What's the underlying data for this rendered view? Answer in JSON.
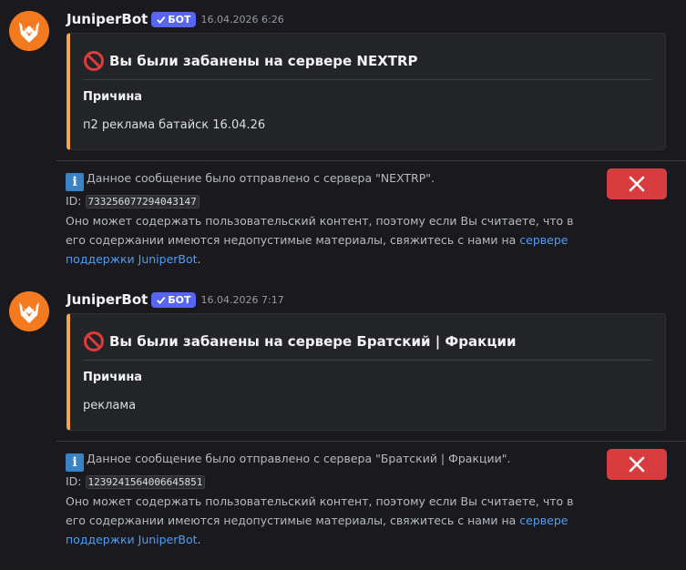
{
  "messages": [
    {
      "author": "JuniperBot",
      "badge": "БОТ",
      "timestamp": "16.04.2026 6:26",
      "embed": {
        "title": "Вы были забанены на сервере NEXTRP",
        "field_name": "Причина",
        "field_value": "п2 реклама батайск 16.04.26"
      },
      "notice": {
        "sent_from": "Данное сообщение было отправлено с сервера \"NEXTRP\".",
        "id_label": "ID:",
        "id_value": "733256077294043147",
        "body": "Оно может содержать пользовательский контент, поэтому если Вы считаете, что в его содержании имеются недопустимые материалы, свяжитесь с нами на ",
        "link_text": "сервере поддержки JuniperBot",
        "end": "."
      }
    },
    {
      "author": "JuniperBot",
      "badge": "БОТ",
      "timestamp": "16.04.2026 7:17",
      "embed": {
        "title": "Вы были забанены на сервере Братский | Фракции",
        "field_name": "Причина",
        "field_value": "реклама"
      },
      "notice": {
        "sent_from": "Данное сообщение было отправлено с сервера \"Братский | Фракции\".",
        "id_label": "ID:",
        "id_value": "1239241564006645851",
        "body": "Оно может содержать пользовательский контент, поэтому если Вы считаете, что в его содержании имеются недопустимые материалы, свяжитесь с нами на ",
        "link_text": "сервере поддержки JuniperBot",
        "end": "."
      }
    }
  ],
  "colors": {
    "accent_bar": "#f5a742",
    "bot_badge": "#5865f2",
    "close_button": "#d83c3e",
    "link": "#4e9cf5",
    "info_icon": "#3b82c4"
  },
  "icons": {
    "avatar": "juniperbot-fox-avatar",
    "badge": "checkmark-icon",
    "embed_title": "no-entry-icon",
    "notice": "info-icon",
    "dismiss": "close-icon"
  }
}
